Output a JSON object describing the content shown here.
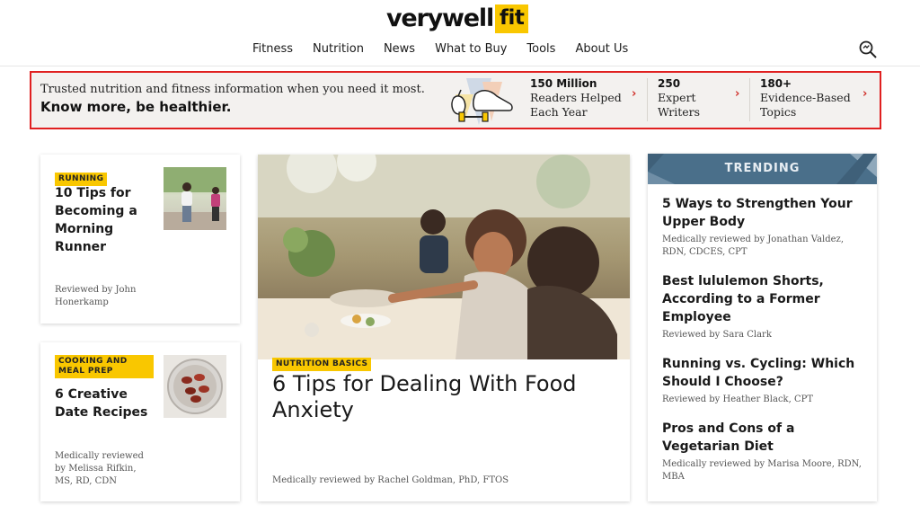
{
  "header": {
    "logo_main": "verywell",
    "logo_accent": "fit",
    "nav": [
      "Fitness",
      "Nutrition",
      "News",
      "What to Buy",
      "Tools",
      "About Us"
    ]
  },
  "banner": {
    "line1": "Trusted nutrition and fitness information when you need it most.",
    "line2": "Know more, be healthier.",
    "stats": [
      {
        "number": "150 Million",
        "line1": "Readers Helped",
        "line2": "Each Year"
      },
      {
        "number": "250",
        "line1": "Expert",
        "line2": "Writers"
      },
      {
        "number": "180+",
        "line1": "Evidence-Based",
        "line2": "Topics"
      }
    ]
  },
  "cards": [
    {
      "tag": "RUNNING",
      "title_lines": [
        "10 Tips for",
        "Becoming a",
        "Morning",
        "Runner"
      ],
      "meta_lines": [
        "Reviewed by John",
        "Honerkamp"
      ]
    },
    {
      "tag_lines": [
        "COOKING AND",
        "MEAL PREP"
      ],
      "title_lines": [
        "6 Creative",
        "Date Recipes"
      ],
      "meta_lines": [
        "Medically reviewed",
        "by Melissa Rifkin,",
        "MS, RD, CDN"
      ]
    }
  ],
  "feature": {
    "tag": "NUTRITION BASICS",
    "title_lines": [
      "6 Tips for Dealing With Food",
      "Anxiety"
    ],
    "meta": "Medically reviewed by Rachel Goldman, PhD, FTOS"
  },
  "trending": {
    "label": "TRENDING",
    "items": [
      {
        "title_lines": [
          "5 Ways to Strengthen Your",
          "Upper Body"
        ],
        "meta_lines": [
          "Medically reviewed by Jonathan Valdez,",
          "RDN, CDCES, CPT"
        ]
      },
      {
        "title_lines": [
          "Best lululemon Shorts,",
          "According to a Former",
          "Employee"
        ],
        "meta_lines": [
          "Reviewed by Sara Clark"
        ]
      },
      {
        "title_lines": [
          "Running vs. Cycling: Which",
          "Should I Choose?"
        ],
        "meta_lines": [
          "Reviewed by Heather Black, CPT"
        ]
      },
      {
        "title_lines": [
          "Pros and Cons of a",
          "Vegetarian Diet"
        ],
        "meta_lines": [
          "Medically reviewed by Marisa Moore, RDN,",
          "MBA"
        ]
      }
    ]
  },
  "colors": {
    "brand_yellow": "#f9c700",
    "banner_border": "#e02020",
    "trending_blue": "#4a6f8a",
    "chevron": "#d0302a"
  },
  "icons": {
    "search": "search-icon",
    "chevron": "chevron-right-icon"
  }
}
